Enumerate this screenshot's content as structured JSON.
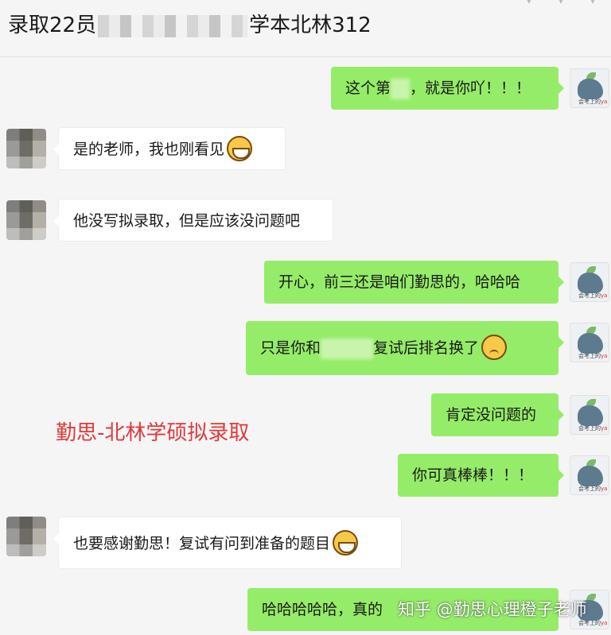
{
  "header": {
    "title_start": "录取22员",
    "title_end": "学本北林312"
  },
  "avatars": {
    "teacher_caption_a": "会考上的",
    "teacher_caption_b": "ya"
  },
  "messages": [
    {
      "side": "out",
      "text": "这个第",
      "text_b": "，就是你吖！！！"
    },
    {
      "side": "in",
      "text": "是的老师，我也刚看见",
      "emoji": "grin"
    },
    {
      "side": "in",
      "text": "他没写拟录取，但是应该没问题吧"
    },
    {
      "side": "out",
      "text": "开心，前三还是咱们勤思的，哈哈哈"
    },
    {
      "side": "out",
      "text": "只是你和",
      "text_b": "复试后排名换了",
      "emoji": "think"
    },
    {
      "side": "out",
      "text": "肯定没问题的"
    },
    {
      "side": "out",
      "text": "你可真棒棒！！！"
    },
    {
      "side": "in",
      "text": "也要感谢勤思！复试有问到准备的题目",
      "emoji": "grin"
    },
    {
      "side": "out",
      "text": "哈哈哈哈哈，真的"
    }
  ],
  "caption": "勤思-北林学硕拟录取",
  "watermark": "知乎 @勤思心理橙子老师",
  "colors": {
    "outgoing_bubble": "#95ec69",
    "incoming_bubble": "#ffffff",
    "caption": "#e0393c",
    "background": "#f5f5f5"
  }
}
